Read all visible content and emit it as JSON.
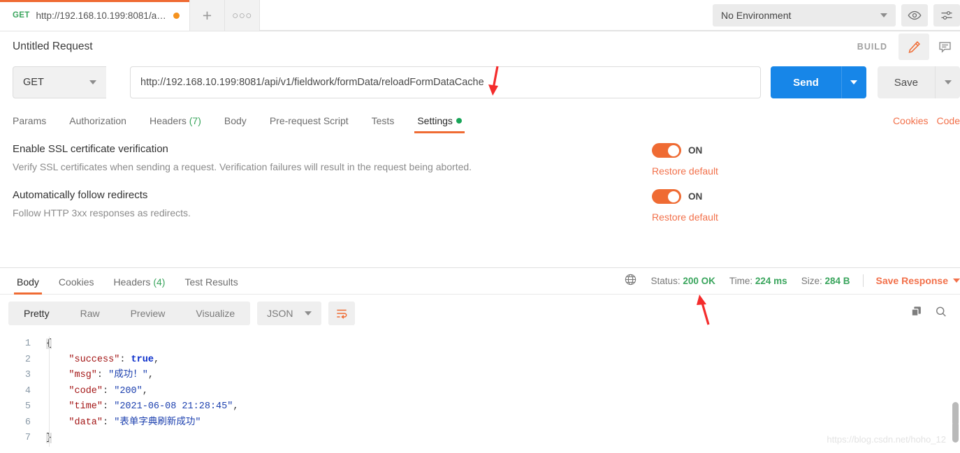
{
  "tabbar": {
    "request_tab": {
      "method": "GET",
      "url_short": "http://192.168.10.199:8081/api/...",
      "unsaved": "●"
    },
    "new_tab_glyph": "+",
    "more_glyph": "●●●",
    "environment": {
      "selected": "No Environment"
    }
  },
  "header": {
    "request_title": "Untitled Request",
    "build_label": "BUILD"
  },
  "url_row": {
    "method": "GET",
    "url": "http://192.168.10.199:8081/api/v1/fieldwork/formData/reloadFormDataCache",
    "send_label": "Send",
    "save_label": "Save"
  },
  "request_tabs": {
    "items": [
      {
        "label": "Params",
        "active": false
      },
      {
        "label": "Authorization",
        "active": false
      },
      {
        "label": "Headers",
        "count": "(7)",
        "active": false
      },
      {
        "label": "Body",
        "active": false
      },
      {
        "label": "Pre-request Script",
        "active": false
      },
      {
        "label": "Tests",
        "active": false
      },
      {
        "label": "Settings",
        "active": true
      }
    ],
    "links": [
      {
        "label": "Cookies"
      },
      {
        "label": "Code"
      }
    ]
  },
  "settings": {
    "rows": [
      {
        "title": "Enable SSL certificate verification",
        "desc": "Verify SSL certificates when sending a request. Verification failures will result in the request being aborted.",
        "toggle_state": "ON",
        "restore_label": "Restore default"
      },
      {
        "title": "Automatically follow redirects",
        "desc": "Follow HTTP 3xx responses as redirects.",
        "toggle_state": "ON",
        "restore_label": "Restore default"
      }
    ]
  },
  "response": {
    "tabs": [
      {
        "label": "Body",
        "active": true
      },
      {
        "label": "Cookies",
        "active": false
      },
      {
        "label": "Headers",
        "count": "(4)",
        "active": false
      },
      {
        "label": "Test Results",
        "active": false
      }
    ],
    "meta": {
      "status_label": "Status:",
      "status_value": "200 OK",
      "time_label": "Time:",
      "time_value": "224 ms",
      "size_label": "Size:",
      "size_value": "284 B",
      "save_response_label": "Save Response"
    },
    "toolbar": {
      "formats": [
        {
          "label": "Pretty",
          "active": true
        },
        {
          "label": "Raw",
          "active": false
        },
        {
          "label": "Preview",
          "active": false
        },
        {
          "label": "Visualize",
          "active": false
        }
      ],
      "content_type": "JSON"
    },
    "body_lines": [
      {
        "n": "1",
        "segments": [
          {
            "t": "{",
            "c": "brace-hl"
          }
        ]
      },
      {
        "n": "2",
        "segments": [
          {
            "t": "    ",
            "c": "p"
          },
          {
            "t": "\"success\"",
            "c": "k"
          },
          {
            "t": ": ",
            "c": "p"
          },
          {
            "t": "true",
            "c": "b"
          },
          {
            "t": ",",
            "c": "p"
          }
        ]
      },
      {
        "n": "3",
        "segments": [
          {
            "t": "    ",
            "c": "p"
          },
          {
            "t": "\"msg\"",
            "c": "k"
          },
          {
            "t": ": ",
            "c": "p"
          },
          {
            "t": "\"成功！\"",
            "c": "s"
          },
          {
            "t": ",",
            "c": "p"
          }
        ]
      },
      {
        "n": "4",
        "segments": [
          {
            "t": "    ",
            "c": "p"
          },
          {
            "t": "\"code\"",
            "c": "k"
          },
          {
            "t": ": ",
            "c": "p"
          },
          {
            "t": "\"200\"",
            "c": "s"
          },
          {
            "t": ",",
            "c": "p"
          }
        ]
      },
      {
        "n": "5",
        "segments": [
          {
            "t": "    ",
            "c": "p"
          },
          {
            "t": "\"time\"",
            "c": "k"
          },
          {
            "t": ": ",
            "c": "p"
          },
          {
            "t": "\"2021-06-08 21:28:45\"",
            "c": "s"
          },
          {
            "t": ",",
            "c": "p"
          }
        ]
      },
      {
        "n": "6",
        "segments": [
          {
            "t": "    ",
            "c": "p"
          },
          {
            "t": "\"data\"",
            "c": "k"
          },
          {
            "t": ": ",
            "c": "p"
          },
          {
            "t": "\"表单字典刷新成功\"",
            "c": "s"
          }
        ]
      },
      {
        "n": "7",
        "segments": [
          {
            "t": "}",
            "c": "brace-hl"
          }
        ]
      }
    ],
    "watermark": "https://blog.csdn.net/hoho_12"
  },
  "colors": {
    "accent_orange": "#ef6b33",
    "link_orange": "#f2704a",
    "send_blue": "#1786e8",
    "success_green": "#3aa55d",
    "annotation_red": "#f42c2c"
  }
}
